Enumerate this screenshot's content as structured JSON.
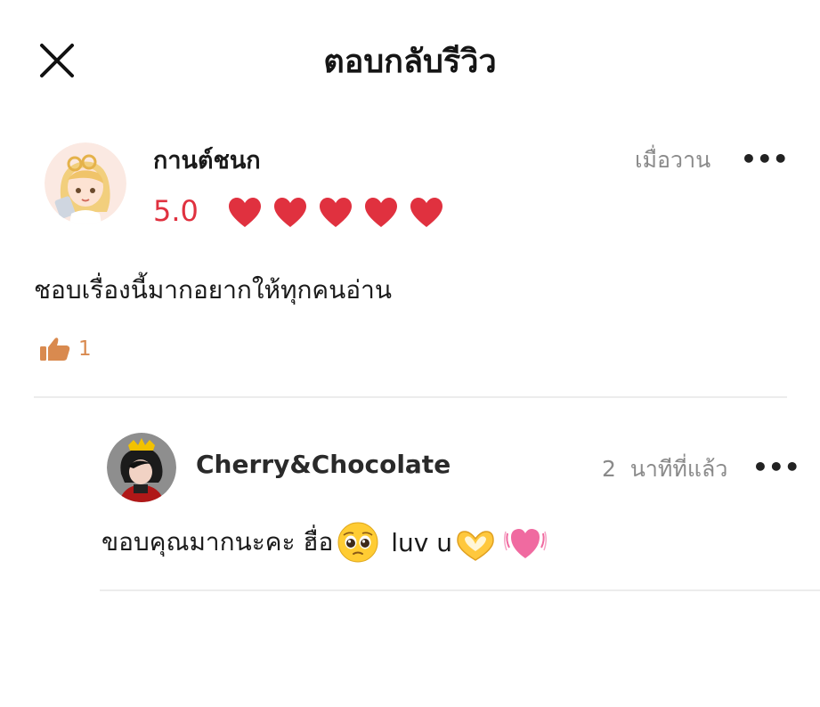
{
  "header": {
    "close_icon": "close-icon",
    "title": "ตอบกลับรีวิว"
  },
  "review": {
    "author": "กานต์ชนก",
    "time": "เมื่อวาน",
    "more_label": "•••",
    "rating": "5.0",
    "hearts_filled": 5,
    "heart_color": "#e0313f",
    "text": "ชอบเรื่องนี้มากอยากให้ทุกคนอ่าน",
    "like_icon": "thumbs-up-icon",
    "like_count": "1",
    "like_color": "#d98a4f"
  },
  "reply": {
    "author": "Cherry&Chocolate",
    "time": "2  นาทีที่แล้ว",
    "more_label": "•••",
    "text_part1": "ขอบคุณมากนะคะ ฮื่อ",
    "text_part2": " luv u",
    "emojis": [
      "pleading-face-emoji",
      "heart-hands-emoji",
      "beating-heart-emoji"
    ]
  }
}
